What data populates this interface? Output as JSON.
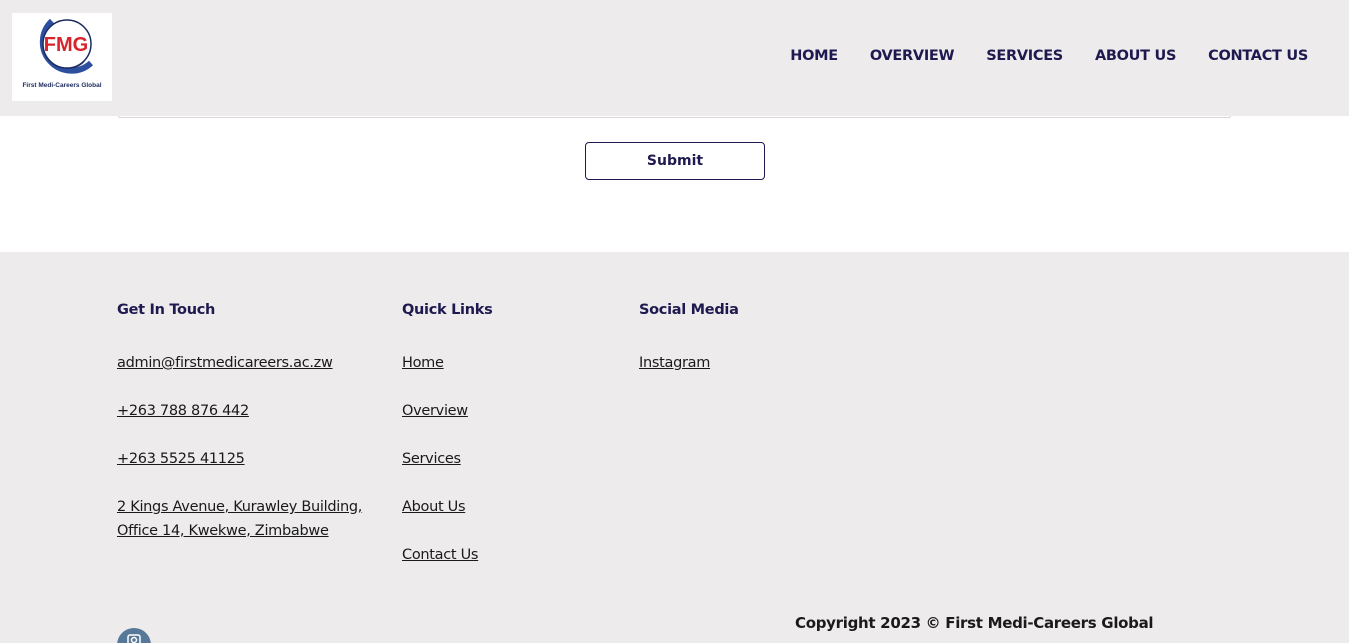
{
  "brand": {
    "logo_text": "FMG",
    "logo_caption": "First Medi-Careers Global",
    "colors": {
      "navy": "#1e1a4f",
      "logo_red": "#d9232a",
      "logo_blue": "#2d4fa0"
    }
  },
  "nav": {
    "items": [
      {
        "label": "HOME"
      },
      {
        "label": "OVERVIEW"
      },
      {
        "label": "SERVICES"
      },
      {
        "label": "ABOUT US"
      },
      {
        "label": "CONTACT US"
      }
    ]
  },
  "form": {
    "submit_label": "Submit"
  },
  "footer": {
    "get_in_touch": {
      "heading": "Get In Touch",
      "email": "admin@firstmedicareers.ac.zw",
      "phone1": "+263 788 876 442",
      "phone2": "+263 5525 41125",
      "address_line1": "2 Kings Avenue, Kurawley Building,",
      "address_line2": "Office 14, Kwekwe, Zimbabwe"
    },
    "quick_links": {
      "heading": "Quick Links",
      "items": [
        "Home",
        "Overview",
        "Services",
        "About Us",
        "Contact Us"
      ]
    },
    "social_media": {
      "heading": "Social Media",
      "items": [
        "Instagram"
      ],
      "icon": "instagram-icon"
    },
    "copyright": "Copyright 2023 © First Medi-Careers Global"
  }
}
